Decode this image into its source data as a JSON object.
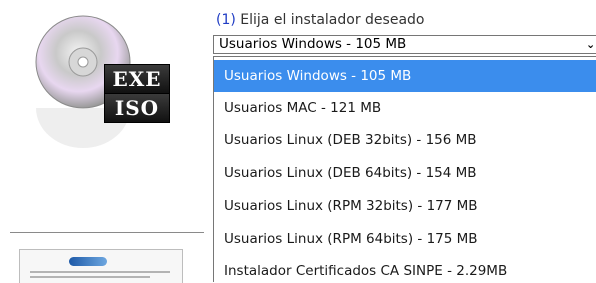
{
  "icon": {
    "name": "disc-exe-iso-icon",
    "badge_top": "EXE",
    "badge_bottom": "ISO"
  },
  "step": {
    "number": "(1)",
    "text": "Elija el instalador deseado"
  },
  "installer_select": {
    "selected": "Usuarios Windows - 105 MB",
    "options": [
      "Usuarios Windows - 105 MB",
      "Usuarios MAC - 121 MB",
      "Usuarios Linux (DEB 32bits) - 156 MB",
      "Usuarios Linux (DEB 64bits) - 154 MB",
      "Usuarios Linux (RPM 32bits) - 177 MB",
      "Usuarios Linux (RPM 64bits) - 175 MB",
      "Instalador Certificados CA SINPE - 2.29MB"
    ]
  },
  "colors": {
    "highlight": "#3b8ded",
    "step_number": "#1f3cc4"
  }
}
